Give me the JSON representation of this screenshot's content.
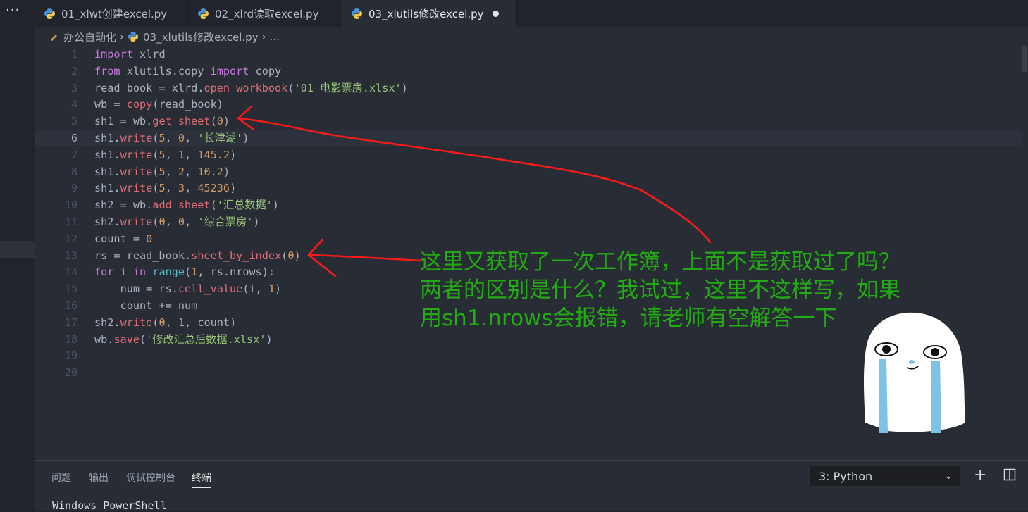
{
  "tabs": [
    {
      "label": "01_xlwt创建excel.py"
    },
    {
      "label": "02_xlrd读取excel.py"
    },
    {
      "label": "03_xlutils修改excel.py"
    }
  ],
  "breadcrumb": {
    "folder": "办公自动化",
    "file": "03_xlutils修改excel.py",
    "more": "..."
  },
  "line_numbers": [
    "1",
    "2",
    "3",
    "4",
    "5",
    "6",
    "7",
    "8",
    "9",
    "10",
    "11",
    "12",
    "13",
    "14",
    "15",
    "16",
    "17",
    "18",
    "19",
    "20"
  ],
  "code_lines": [
    "import xlrd",
    "from xlutils.copy import copy",
    "read_book = xlrd.open_workbook('01_电影票房.xlsx')",
    "wb = copy(read_book)",
    "sh1 = wb.get_sheet(0)",
    "sh1.write(5, 0, '长津湖')",
    "sh1.write(5, 1, 145.2)",
    "sh1.write(5, 2, 10.2)",
    "sh1.write(5, 3, 45236)",
    "sh2 = wb.add_sheet('汇总数据')",
    "sh2.write(0, 0, '综合票房')",
    "count = 0",
    "rs = read_book.sheet_by_index(0)",
    "for i in range(1, rs.nrows):",
    "    num = rs.cell_value(i, 1)",
    "    count += num",
    "sh2.write(0, 1, count)",
    "wb.save('修改汇总后数据.xlsx')",
    "",
    ""
  ],
  "annotation": {
    "lines": [
      "这里又获取了一次工作簿，上面不是获取过了吗？",
      "两者的区别是什么？我试过，这里不这样写，如果",
      "用sh1.nrows会报错，请老师有空解答一下"
    ]
  },
  "panel": {
    "tabs": [
      "问题",
      "输出",
      "调试控制台",
      "终端"
    ],
    "terminal_select": "3: Python",
    "terminal_text": "Windows PowerShell"
  },
  "colors": {
    "annotation": "#22ab12",
    "arrow": "#ff1a1a"
  }
}
